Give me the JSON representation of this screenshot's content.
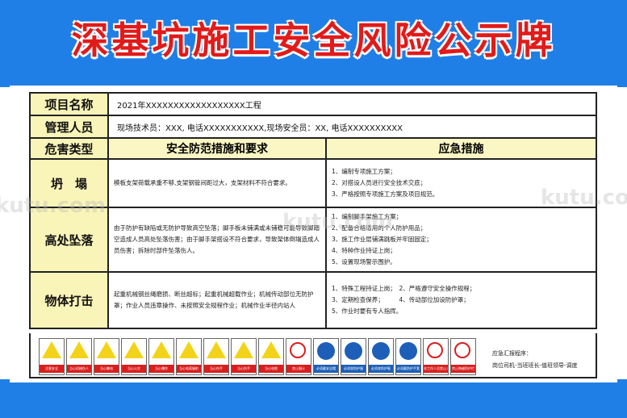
{
  "title": "深基坑施工安全风险公示牌",
  "project": {
    "label": "项目名称",
    "value": "2021年XXXXXXXXXXXXXXXXXX工程"
  },
  "manager": {
    "label": "管理人员",
    "value": "现场技术员：XXX, 电话XXXXXXXXXXX,现场安全员：XX, 电话XXXXXXXXXX"
  },
  "headers": {
    "type": "危害类型",
    "measures": "安全防范措施和要求",
    "emergency": "应急措施"
  },
  "rows": [
    {
      "type": "坍　塌",
      "measures": "模板支架荷载承重不够,支架钢管间距过大，支架材料不符合要求。",
      "emergency": "1、编制专项施工方案；\n2、对搭设人员进行安全技术交底；\n3、严格按照专项施工方案及项目规范。"
    },
    {
      "type": "高处坠落",
      "measures": "由于防护有缺陷或无防护导致高空坠落；脚手板未铺满或未铺稳可能导致脚踏空造成人员高处坠落伤害；由于脚手架搭设不符合要求，导致架体倒塌造成人员伤害；拆除时部件坠落伤人。",
      "emergency": "1、编制脚手架施工方案；\n2、配备合格适用的个人防护用品；\n3、施工作业层铺满跳板并牢固固定；\n4、特种作业持证上岗；\n5、设置现场警示围护。"
    },
    {
      "type": "物体打击",
      "measures": "起重机械钢丝绳磨损、断丝超标；起重机械超载作业；机械传动部位无防护罩；作业人员违章操作、未按照安全规程作业；机械作业半径内站人",
      "emergency": "1、特殊工程持证上岗；　2、严格遵守安全操作规程；\n3、定期检查保养；　　　4、传动部位加设防护罩；\n5、作业时要有专人指挥。"
    }
  ],
  "signs": [
    {
      "icon": "warning-general-icon",
      "caption": "注意安全"
    },
    {
      "icon": "warning-machine-injury-icon",
      "caption": "当心机械伤人"
    },
    {
      "icon": "warning-electric-icon",
      "caption": "当心触电"
    },
    {
      "icon": "warning-fire-icon",
      "caption": "当心火灾"
    },
    {
      "icon": "warning-explosion-icon",
      "caption": "当心爆炸"
    },
    {
      "icon": "warning-radiation-icon",
      "caption": "当心电离辐射"
    },
    {
      "icon": "warning-injury-icon",
      "caption": "当心伤手"
    },
    {
      "icon": "warning-hand-icon",
      "caption": "当心伤手"
    },
    {
      "icon": "warning-electric2-icon",
      "caption": "当心电缆"
    },
    {
      "icon": "no-smoking-icon",
      "caption": "禁止烟火"
    },
    {
      "icon": "helmet-icon",
      "caption": "必须戴安全帽"
    },
    {
      "icon": "protective-clothing-icon",
      "caption": "必须穿防护服"
    },
    {
      "icon": "protective-shoes-icon",
      "caption": "必须穿防护鞋"
    },
    {
      "icon": "protective-gloves-icon",
      "caption": "必须戴防护手套"
    },
    {
      "icon": "no-entry-icon",
      "caption": "非工作人员禁止入内"
    },
    {
      "icon": "no-climb-icon",
      "caption": "禁止跨越防护栏"
    }
  ],
  "emergency_note": {
    "line1": "应急汇报程序：",
    "line2": "岗位司机-当班班长-值班领导-调度"
  },
  "watermark": "kutu.com",
  "colors": {
    "blue": "#1f7fe6",
    "red": "#e21a1a",
    "yellow": "#f9f4b8"
  }
}
